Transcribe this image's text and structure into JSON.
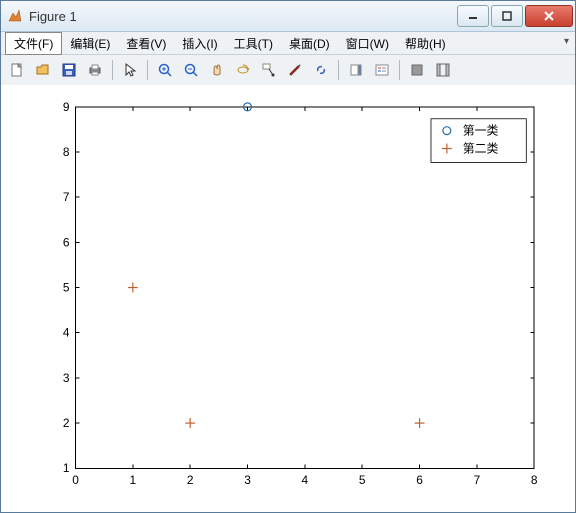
{
  "window": {
    "title": "Figure 1"
  },
  "menubar": {
    "items": [
      "文件(F)",
      "编辑(E)",
      "查看(V)",
      "插入(I)",
      "工具(T)",
      "桌面(D)",
      "窗口(W)",
      "帮助(H)"
    ],
    "selected_index": 0
  },
  "toolbar": {
    "tooltips": [
      "New",
      "Open",
      "Save",
      "Print",
      "Pointer",
      "Zoom In",
      "Zoom Out",
      "Pan",
      "Rotate 3D",
      "Data Cursor",
      "Brush",
      "Link",
      "Insert Colorbar",
      "Insert Legend",
      "Hide Plot Tools",
      "Show Plot Tools"
    ]
  },
  "legend": {
    "entry1": "第一类",
    "entry2": "第二类"
  },
  "chart_data": {
    "type": "scatter",
    "xlabel": "",
    "ylabel": "",
    "title": "",
    "xlim": [
      0,
      8
    ],
    "ylim": [
      1,
      9
    ],
    "xticks": [
      0,
      1,
      2,
      3,
      4,
      5,
      6,
      7,
      8
    ],
    "yticks": [
      1,
      2,
      3,
      4,
      5,
      6,
      7,
      8,
      9
    ],
    "series": [
      {
        "name": "第一类",
        "marker": "circle",
        "color": "#1f6fb0",
        "points": [
          {
            "x": 3,
            "y": 9
          }
        ]
      },
      {
        "name": "第二类",
        "marker": "plus",
        "color": "#c06030",
        "points": [
          {
            "x": 1,
            "y": 5
          },
          {
            "x": 2,
            "y": 2
          },
          {
            "x": 6,
            "y": 2
          }
        ]
      }
    ]
  },
  "labels": {
    "xt0": "0",
    "xt1": "1",
    "xt2": "2",
    "xt3": "3",
    "xt4": "4",
    "xt5": "5",
    "xt6": "6",
    "xt7": "7",
    "xt8": "8",
    "yt1": "1",
    "yt2": "2",
    "yt3": "3",
    "yt4": "4",
    "yt5": "5",
    "yt6": "6",
    "yt7": "7",
    "yt8": "8",
    "yt9": "9"
  }
}
